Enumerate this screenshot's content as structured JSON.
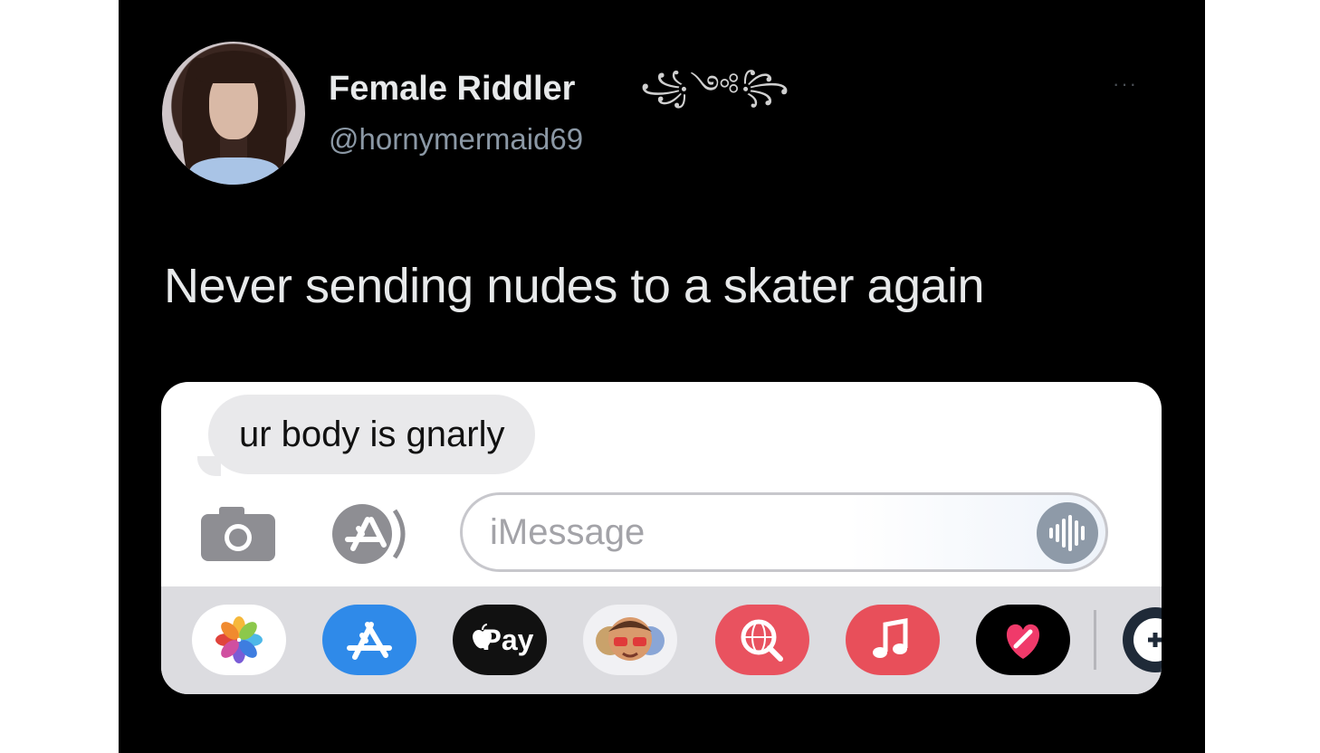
{
  "tweet": {
    "display_name": "Female Riddler",
    "name_decoration": "꧁༺꧂",
    "handle": "@hornymermaid69",
    "more_label": "···",
    "text": "Never sending nudes to a skater again"
  },
  "imessage": {
    "incoming_message": "ur body is gnarly",
    "input_placeholder": "iMessage",
    "apple_pay_label": "Pay",
    "app_tray": [
      "photos-icon",
      "app-store-icon",
      "apple-pay-icon",
      "memoji-icon",
      "search-images-icon",
      "music-icon",
      "digital-touch-icon",
      "more-apps-icon"
    ]
  },
  "colors": {
    "tweet_background": "#000000",
    "tweet_text": "#e7e9ea",
    "handle_text": "#8b98a5",
    "bubble_background": "#e9e9eb",
    "app_store_blue": "#2f8ae9",
    "music_red": "#e84f5a",
    "search_red": "#e9525f"
  }
}
